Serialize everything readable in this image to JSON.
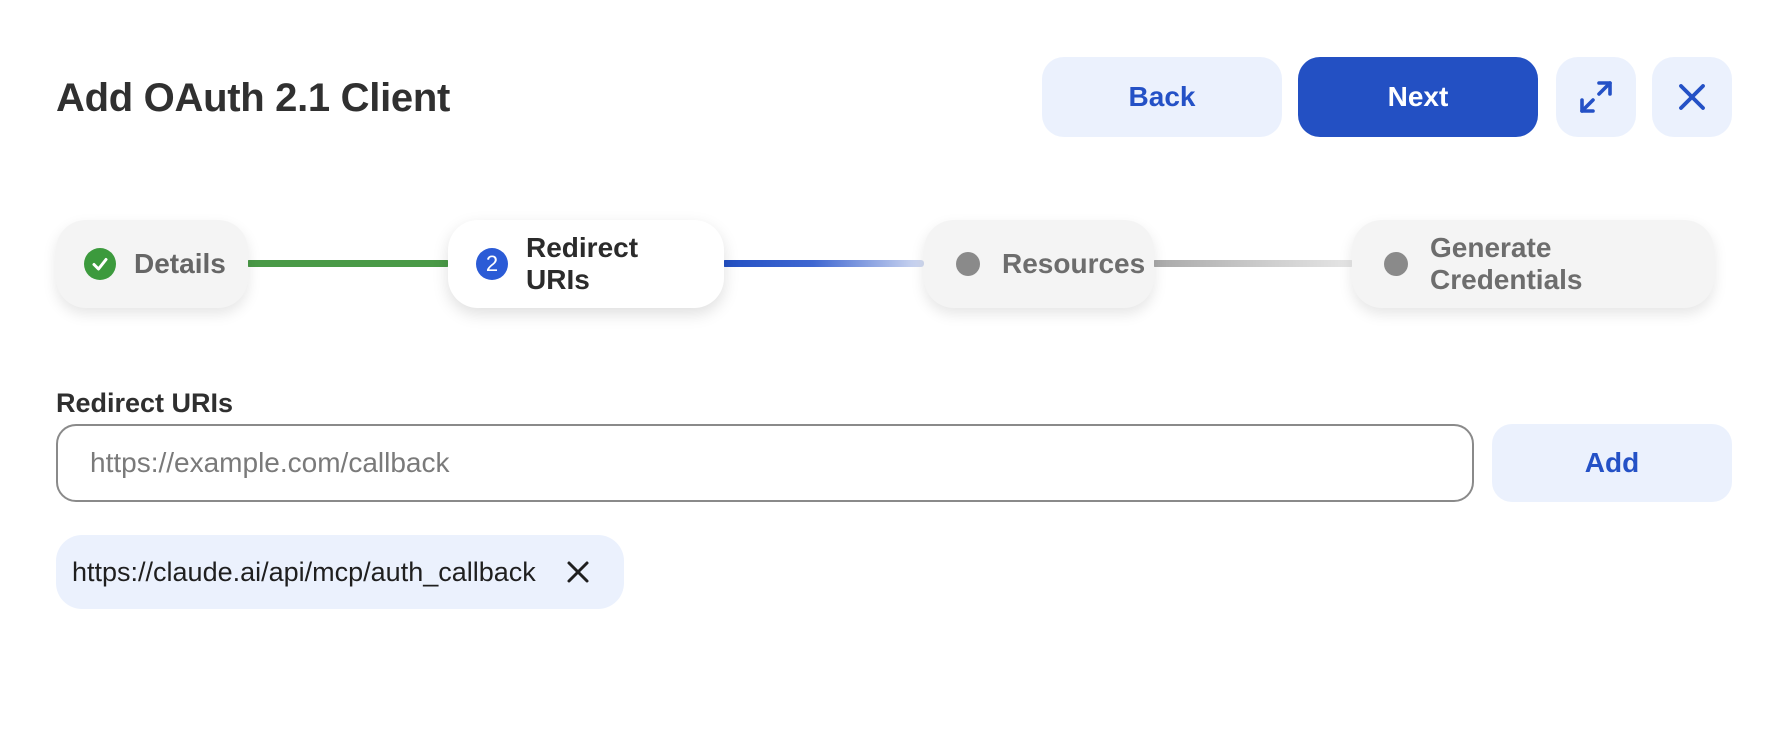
{
  "dialog": {
    "title": "Add OAuth 2.1 Client"
  },
  "header": {
    "back_label": "Back",
    "next_label": "Next",
    "expand_icon": "expand-icon",
    "close_icon": "close-icon"
  },
  "stepper": {
    "steps": [
      {
        "label": "Details",
        "status": "completed",
        "icon": "check-circle-icon"
      },
      {
        "label": "Redirect URIs",
        "status": "active",
        "number": "2"
      },
      {
        "label": "Resources",
        "status": "pending",
        "icon": "dot-icon"
      },
      {
        "label": "Generate Credentials",
        "status": "pending",
        "icon": "dot-icon"
      }
    ]
  },
  "redirect_uris": {
    "label": "Redirect URIs",
    "placeholder": "https://example.com/callback",
    "value": "",
    "add_label": "Add",
    "items": [
      {
        "uri": "https://claude.ai/api/mcp/auth_callback",
        "remove_icon": "remove-icon"
      }
    ]
  },
  "colors": {
    "primary": "#2350c3",
    "primary_light": "#ebf1fd",
    "success": "#3c9a3d",
    "pending": "#8a8a8a"
  }
}
